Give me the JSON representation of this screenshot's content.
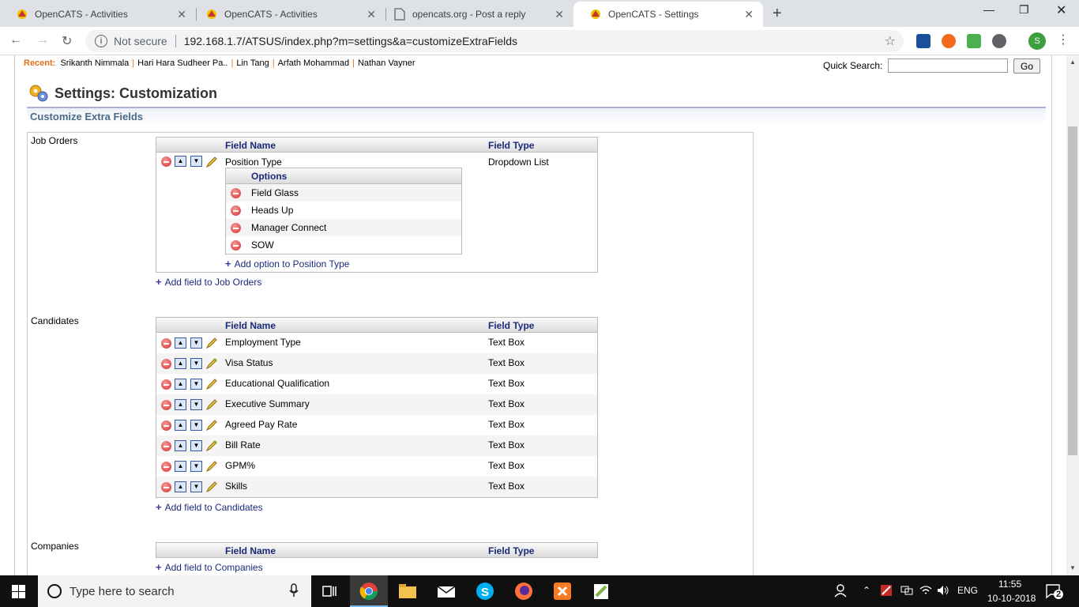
{
  "browser": {
    "tabs": [
      {
        "title": "OpenCATS - Activities",
        "active": false
      },
      {
        "title": "OpenCATS - Activities",
        "active": false
      },
      {
        "title": "opencats.org - Post a reply",
        "active": false
      },
      {
        "title": "OpenCATS - Settings",
        "active": true
      }
    ],
    "security_label": "Not secure",
    "url": "192.168.1.7/ATSUS/index.php?m=settings&a=customizeExtraFields",
    "profile_initial": "S"
  },
  "header": {
    "recent_label": "Recent:",
    "recent_items": [
      "Srikanth Nimmala",
      "Hari Hara Sudheer Pa..",
      "Lin Tang",
      "Arfath Mohammad",
      "Nathan Vayner"
    ],
    "quick_search_label": "Quick Search:",
    "go_label": "Go"
  },
  "page": {
    "title": "Settings: Customization",
    "subtitle": "Customize Extra Fields",
    "col_field_name": "Field Name",
    "col_field_type": "Field Type",
    "options_label": "Options"
  },
  "sections": {
    "job_orders": {
      "label": "Job Orders",
      "fields": [
        {
          "name": "Position Type",
          "type": "Dropdown List"
        }
      ],
      "options": [
        "Field Glass",
        "Heads Up",
        "Manager Connect",
        "SOW"
      ],
      "add_option": "Add option to Position Type",
      "add_field": "Add field to Job Orders"
    },
    "candidates": {
      "label": "Candidates",
      "fields": [
        {
          "name": "Employment Type",
          "type": "Text Box"
        },
        {
          "name": "Visa Status",
          "type": "Text Box"
        },
        {
          "name": "Educational Qualification",
          "type": "Text Box"
        },
        {
          "name": "Executive Summary",
          "type": "Text Box"
        },
        {
          "name": "Agreed Pay Rate",
          "type": "Text Box"
        },
        {
          "name": "Bill Rate",
          "type": "Text Box"
        },
        {
          "name": "GPM%",
          "type": "Text Box"
        },
        {
          "name": "Skills",
          "type": "Text Box"
        }
      ],
      "add_field": "Add field to Candidates"
    },
    "companies": {
      "label": "Companies",
      "add_field": "Add field to Companies"
    }
  },
  "taskbar": {
    "search_placeholder": "Type here to search",
    "lang": "ENG",
    "time": "11:55",
    "date": "10-10-2018",
    "notif_count": "2"
  }
}
